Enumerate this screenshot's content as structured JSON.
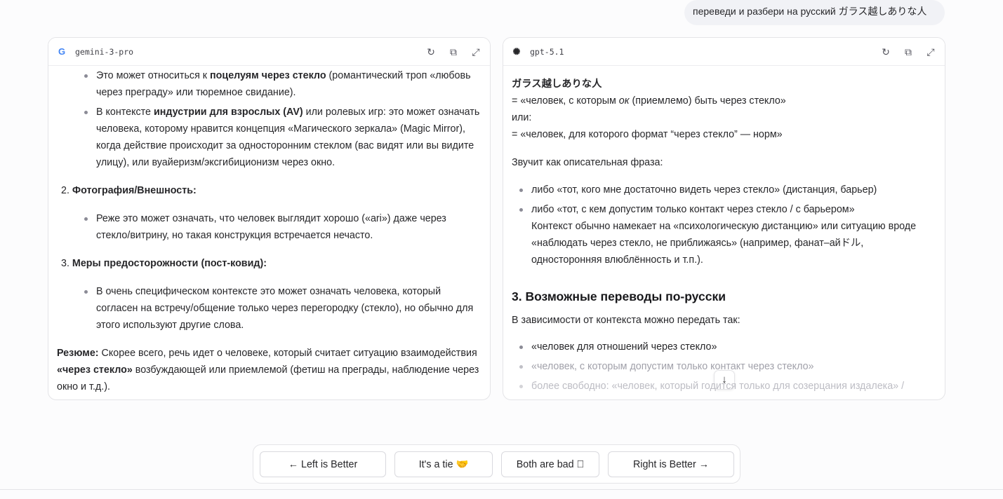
{
  "prompt": "переведи и разбери на русский ガラス越しありな人",
  "left": {
    "model": "gemini-3-pro",
    "icon": "google-icon",
    "b1a_pre": "Это может относиться к ",
    "b1a_bold": "поцелуям через стекло",
    "b1a_post": " (романтический троп «любовь через преграду» или тюремное свидание).",
    "b1b_pre": "В контексте ",
    "b1b_bold": "индустрии для взрослых (AV)",
    "b1b_post": " или ролевых игр: это может означать человека, которому нравится концепция «Магического зеркала» (Magic Mirror), когда действие происходит за односторонним стеклом (вас видят или вы видите улицу), или вуайеризм/эксгибиционизм через окно.",
    "n2": "2.",
    "h2": "Фотография/Внешность:",
    "b2": "Реже это может означать, что человек выглядит хорошо («ari») даже через стекло/витрину, но такая конструкция встречается нечасто.",
    "n3": "3.",
    "h3": "Меры предосторожности (пост-ковид):",
    "b3": "В очень специфическом контексте это может означать человека, который согласен на встречу/общение только через перегородку (стекло), но обычно для этого используют другие слова.",
    "sum_label": "Резюме:",
    "sum_a": " Скорее всего, речь идет о человеке, который считает ситуацию взаимодействия ",
    "sum_bold": "«через стекло»",
    "sum_b": " возбуждающей или приемлемой (фетиш на преграды, наблюдение через окно и т.д.)."
  },
  "right": {
    "model": "gpt-5.1",
    "icon": "openai-icon",
    "phrase": "ガラス越しありな人",
    "l1a": "= «человек, с которым ",
    "l1i": "ок",
    "l1b": " (приемлемо) быть через стекло»",
    "or": "или:",
    "l2": "= «человек, для которого формат “через стекло” — норм»",
    "sounds": "Звучит как описательная фраза:",
    "s1": "либо «тот, кого мне достаточно видеть через стекло» (дистанция, барьер)",
    "s2": "либо «тот, с кем допустим только контакт через стекло / с барьером»",
    "s2b": "Контекст обычно намекает на «психологическую дистанцию» или ситуацию вроде «наблюдать через стекло, не приближаясь» (например, фанат–айドル, односторонняя влюблённость и т.п.).",
    "h3": "3. Возможные переводы по-русски",
    "intro": "В зависимости от контекста можно передать так:",
    "t1": "«человек для отношений через стекло»",
    "t2": "«человек, с которым допустим только контакт через стекло»",
    "t3": "более свободно: «человек, который годится только для созерцания издалека» /"
  },
  "actions": {
    "regenerate": "refresh-icon",
    "copy": "copy-icon",
    "expand": "expand-icon"
  },
  "vote": {
    "left": "← Left is Better",
    "tie": "It's a tie 🤝",
    "bad": "Both are bad ⃠",
    "right": "Right is Better →"
  }
}
